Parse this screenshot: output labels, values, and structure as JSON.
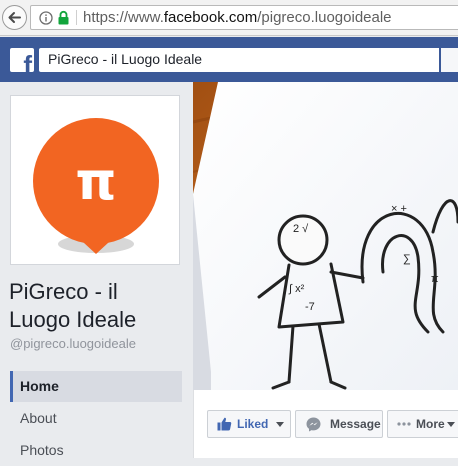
{
  "browser": {
    "url_prefix": "https://www.",
    "url_domain": "facebook.com",
    "url_path": "/pigreco.luogoideale"
  },
  "header": {
    "logo_letter": "f",
    "search_value": "PiGreco - il Luogo Ideale"
  },
  "profile": {
    "logo_symbol": "π",
    "name": "PiGreco - il Luogo Ideale",
    "handle": "@pigreco.luogoideale",
    "brand_color": "#f26522"
  },
  "nav": {
    "items": [
      {
        "label": "Home",
        "active": true
      },
      {
        "label": "About",
        "active": false
      },
      {
        "label": "Photos",
        "active": false
      }
    ]
  },
  "actions": {
    "liked_label": "Liked",
    "message_label": "Message",
    "more_label": "More"
  },
  "colors": {
    "facebook_blue": "#3b5998",
    "link_blue": "#4267b2"
  }
}
